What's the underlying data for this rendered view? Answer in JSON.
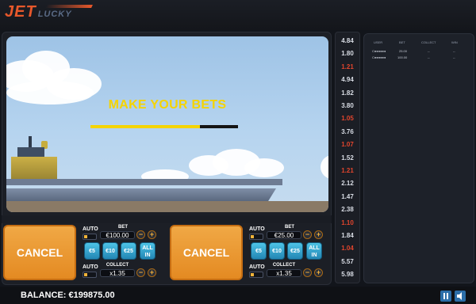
{
  "logo": {
    "part1": "JET",
    "part2": "LUCKY"
  },
  "scene": {
    "message": "MAKE YOUR BETS",
    "bet_timer_fraction": 0.74
  },
  "panels": [
    {
      "cancel_label": "CANCEL",
      "auto_label": "AUTO",
      "bet_label": "BET",
      "bet_value": "€100.00",
      "minus": "−",
      "plus": "+",
      "chips": [
        "€5",
        "€10",
        "€25"
      ],
      "allin": [
        "ALL",
        "IN"
      ],
      "collect_label": "COLLECT",
      "collect_value": "x1.35"
    },
    {
      "cancel_label": "CANCEL",
      "auto_label": "AUTO",
      "bet_label": "BET",
      "bet_value": "€25.00",
      "minus": "−",
      "plus": "+",
      "chips": [
        "€5",
        "€10",
        "€25"
      ],
      "allin": [
        "ALL",
        "IN"
      ],
      "collect_label": "COLLECT",
      "collect_value": "x1.35"
    }
  ],
  "multipliers": [
    {
      "v": "4.84",
      "red": false
    },
    {
      "v": "1.80",
      "red": false
    },
    {
      "v": "1.21",
      "red": true
    },
    {
      "v": "4.94",
      "red": false
    },
    {
      "v": "1.82",
      "red": false
    },
    {
      "v": "3.80",
      "red": false
    },
    {
      "v": "1.05",
      "red": true
    },
    {
      "v": "3.76",
      "red": false
    },
    {
      "v": "1.07",
      "red": true
    },
    {
      "v": "1.52",
      "red": false
    },
    {
      "v": "1.21",
      "red": true
    },
    {
      "v": "2.12",
      "red": false
    },
    {
      "v": "1.47",
      "red": false
    },
    {
      "v": "2.38",
      "red": false
    },
    {
      "v": "1.10",
      "red": true
    },
    {
      "v": "1.84",
      "red": false
    },
    {
      "v": "1.04",
      "red": true
    },
    {
      "v": "5.57",
      "red": false
    },
    {
      "v": "5.98",
      "red": false
    }
  ],
  "users": {
    "headers": [
      "USER",
      "BET",
      "COLLECT",
      "WIN"
    ],
    "rows": [
      [
        "C●●●●●●",
        "25.00",
        "--",
        "--"
      ],
      [
        "C●●●●●●",
        "100.00",
        "--",
        "--"
      ]
    ]
  },
  "bottom": {
    "balance_label": "BALANCE:",
    "balance_value": "€199875.00"
  },
  "colors": {
    "accent": "#f5d400",
    "cancel": "#e8962e",
    "chip": "#2f9fd0",
    "low_multiplier": "#e2452d"
  },
  "icons": {
    "pause": "pause-icon",
    "sound": "speaker-icon"
  }
}
